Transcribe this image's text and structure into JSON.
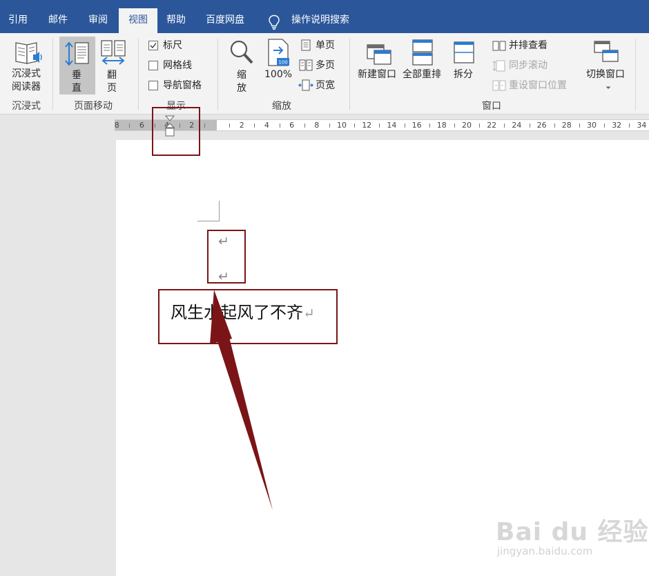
{
  "tabs": [
    "引用",
    "邮件",
    "审阅",
    "视图",
    "帮助",
    "百度网盘"
  ],
  "active_tab_index": 3,
  "tell_me": "操作说明搜索",
  "ribbon": {
    "immersive": {
      "reader_label_1": "沉浸式",
      "reader_label_2": "阅读器",
      "group": "沉浸式"
    },
    "page_move": {
      "vertical_1": "垂",
      "vertical_2": "直",
      "flip_1": "翻",
      "flip_2": "页",
      "group": "页面移动"
    },
    "show": {
      "ruler": "标尺",
      "gridlines": "网格线",
      "nav_pane": "导航窗格",
      "group": "显示",
      "ruler_checked": true,
      "gridlines_checked": false,
      "nav_pane_checked": false
    },
    "zoom": {
      "zoom_1": "缩",
      "zoom_2": "放",
      "hundred": "100%",
      "one_page": "单页",
      "multi_page": "多页",
      "page_width": "页宽",
      "group": "缩放"
    },
    "window": {
      "new_window": "新建窗口",
      "arrange_all": "全部重排",
      "split": "拆分",
      "side_by_side": "并排查看",
      "sync_scroll": "同步滚动",
      "reset_position": "重设窗口位置",
      "switch_window": "切换窗口",
      "group": "窗口"
    }
  },
  "ruler": {
    "left_labels": [
      "8",
      "6",
      "4",
      "2"
    ],
    "right_labels": [
      "2",
      "4",
      "6",
      "8",
      "10",
      "12",
      "14",
      "16",
      "18",
      "20",
      "22",
      "24",
      "26",
      "28",
      "30",
      "32",
      "34"
    ]
  },
  "document": {
    "text_line": "风生水起风了不齐",
    "para_mark": "↵"
  },
  "watermark": {
    "logo": "Bai du 经验",
    "url": "jingyan.baidu.com"
  },
  "colors": {
    "tab_bar": "#2b579a",
    "ribbon_bg": "#f3f3f3",
    "highlight_box": "#7b1416",
    "arrow": "#7b1416"
  }
}
